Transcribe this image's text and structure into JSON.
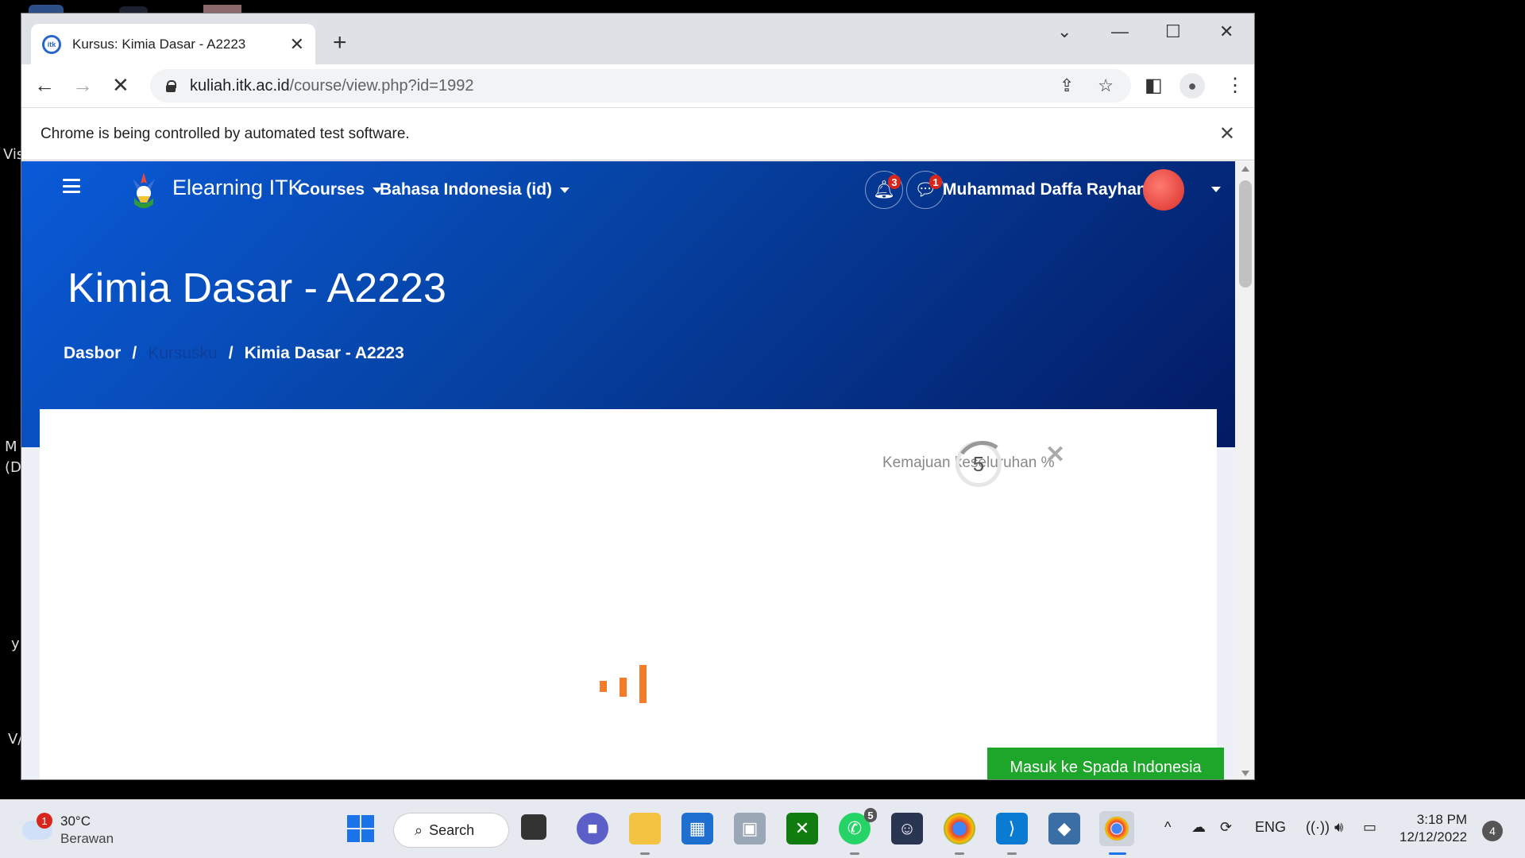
{
  "browser": {
    "tab_title": "Kursus: Kimia Dasar - A2223",
    "url_host": "kuliah.itk.ac.id",
    "url_path": "/course/view.php?id=1992",
    "infobar_text": "Chrome is being controlled by automated test software."
  },
  "site": {
    "brand": "Elearning ITK",
    "menu_courses": "Courses",
    "menu_language": "Bahasa Indonesia (id)",
    "notifications_count": "3",
    "messages_count": "1",
    "user_name": "Muhammad Daffa Rayhan"
  },
  "course": {
    "title": "Kimia Dasar - A2223",
    "breadcrumb": [
      "Dasbor",
      "/",
      "Kursusku",
      "/",
      "Kimia Dasar - A2223"
    ],
    "progress_label": "Kemajuan keseluruhan %",
    "progress_value": "5",
    "spada_button": "Masuk ke Spada Indonesia"
  },
  "desktop_fragments": [
    "Vis",
    "M",
    "(D",
    "y",
    "V/"
  ],
  "taskbar": {
    "weather_badge": "1",
    "temperature": "30°C",
    "condition": "Berawan",
    "search_label": "Search",
    "whatsapp_badge": "5",
    "language": "ENG",
    "time": "3:18 PM",
    "date": "12/12/2022",
    "notification_count": "4"
  },
  "colors": {
    "hero_start": "#0a5ad8",
    "hero_end": "#031a63",
    "spada_green": "#1ea62a",
    "loader_orange": "#f47b2a",
    "badge_red": "#d9261c"
  }
}
